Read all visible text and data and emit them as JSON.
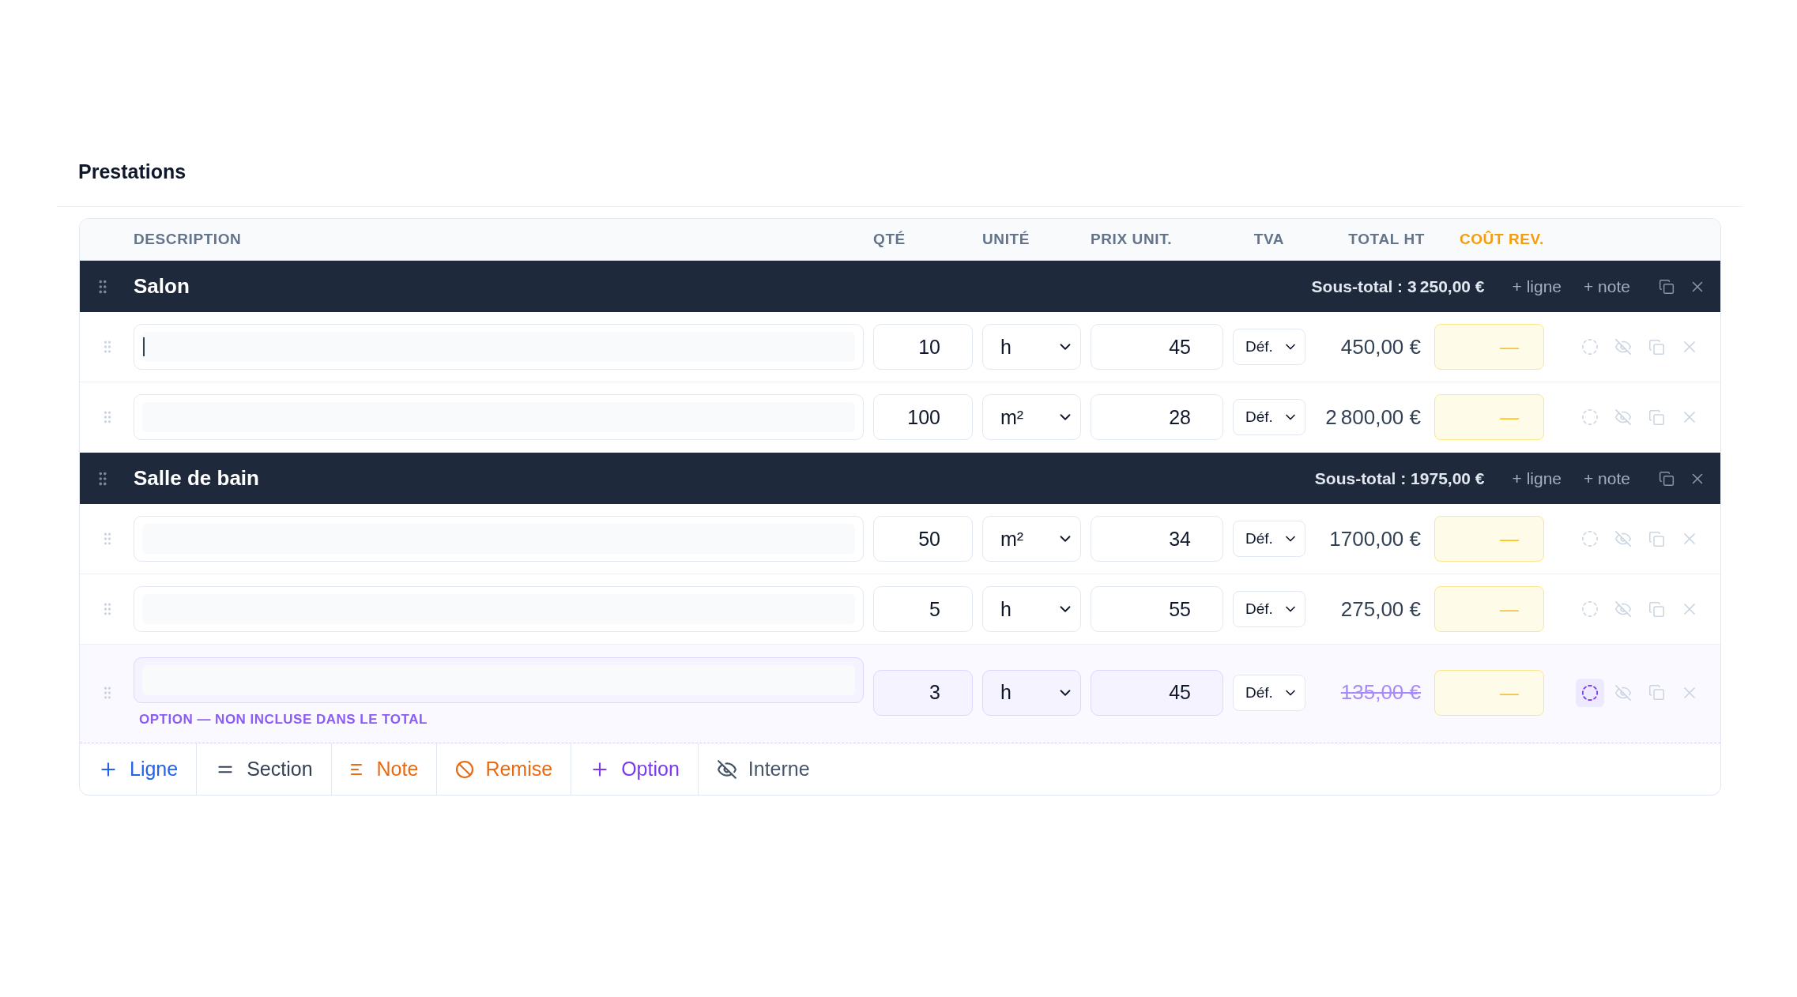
{
  "title": "Prestations",
  "columns": [
    {
      "label": "DESCRIPTION",
      "highlighted": false
    },
    {
      "label": "QTÉ",
      "highlighted": false
    },
    {
      "label": "UNITÉ",
      "highlighted": false
    },
    {
      "label": "PRIX UNIT.",
      "highlighted": false
    },
    {
      "label": "TVA",
      "highlighted": false
    },
    {
      "label": "TOTAL HT",
      "highlighted": false
    },
    {
      "label": "COÛT REV.",
      "highlighted": true
    }
  ],
  "sections": [
    {
      "title": "Salon",
      "subtotal": "Sous-total : 3 250,00 €",
      "actions": [
        "+ ligne",
        "+ note"
      ],
      "items": [
        {
          "focused": true,
          "option": false,
          "quantity": "10",
          "unit": "h",
          "unit_price": "45",
          "vat": "Déf.",
          "total": "450,00 €",
          "cost": "—"
        },
        {
          "focused": false,
          "option": false,
          "quantity": "100",
          "unit": "m²",
          "unit_price": "28",
          "vat": "Déf.",
          "total": "2 800,00 €",
          "cost": "—"
        }
      ]
    },
    {
      "title": "Salle de bain",
      "subtotal": "Sous-total : 1975,00 €",
      "actions": [
        "+ ligne",
        "+ note"
      ],
      "items": [
        {
          "focused": false,
          "option": false,
          "quantity": "50",
          "unit": "m²",
          "unit_price": "34",
          "vat": "Déf.",
          "total": "1700,00 €",
          "cost": "—"
        },
        {
          "focused": false,
          "option": false,
          "quantity": "5",
          "unit": "h",
          "unit_price": "55",
          "vat": "Déf.",
          "total": "275,00 €",
          "cost": "—"
        },
        {
          "focused": false,
          "option": true,
          "quantity": "3",
          "unit": "h",
          "unit_price": "45",
          "vat": "Déf.",
          "total": "135,00 €",
          "cost": "—",
          "note": "OPTION — NON INCLUSE DANS LE TOTAL"
        }
      ]
    }
  ],
  "toolbar": [
    {
      "kind": "line",
      "label": "Ligne"
    },
    {
      "kind": "section",
      "label": "Section"
    },
    {
      "kind": "note",
      "label": "Note"
    },
    {
      "kind": "discount",
      "label": "Remise"
    },
    {
      "kind": "option",
      "label": "Option"
    },
    {
      "kind": "internal",
      "label": "Interne"
    }
  ]
}
